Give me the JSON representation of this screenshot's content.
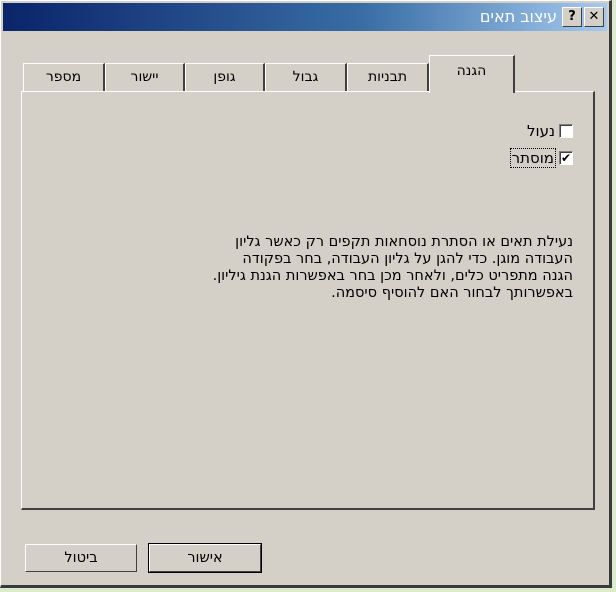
{
  "window": {
    "title": "עיצוב תאים",
    "help_icon": "help-icon",
    "close_icon": "close-icon"
  },
  "tabs": [
    {
      "label": "מספר"
    },
    {
      "label": "יישור"
    },
    {
      "label": "גופן"
    },
    {
      "label": "גבול"
    },
    {
      "label": "תבניות"
    },
    {
      "label": "הגנה",
      "active": true
    }
  ],
  "protection": {
    "locked": {
      "label": "נעול",
      "checked": false
    },
    "hidden": {
      "label": "מוסתר",
      "checked": true
    },
    "description": [
      "נעילת תאים או הסתרת נוסחאות תקפים רק כאשר גליון",
      "העבודה מוגן. כדי להגן על גליון העבודה, בחר בפקודה",
      "הגנה מתפריט כלים, ולאחר מכן בחר באפשרות הגנת גיליון.",
      "באפשרותך לבחור האם להוסיף סיסמה."
    ]
  },
  "buttons": {
    "ok": "אישור",
    "cancel": "ביטול"
  }
}
